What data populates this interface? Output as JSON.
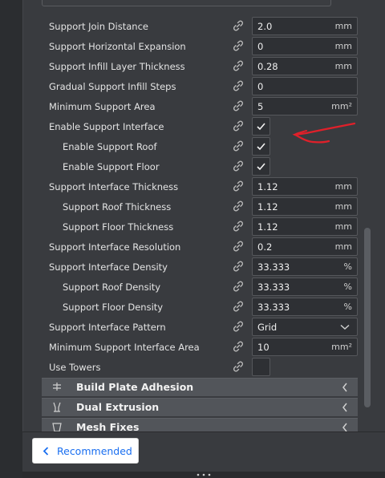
{
  "settings": [
    {
      "label": "Support Join Distance",
      "value": "2.0",
      "unit": "mm",
      "control": "field",
      "indent": 0
    },
    {
      "label": "Support Horizontal Expansion",
      "value": "0",
      "unit": "mm",
      "control": "field",
      "indent": 0
    },
    {
      "label": "Support Infill Layer Thickness",
      "value": "0.28",
      "unit": "mm",
      "control": "field",
      "indent": 0
    },
    {
      "label": "Gradual Support Infill Steps",
      "value": "0",
      "unit": "",
      "control": "field",
      "indent": 0
    },
    {
      "label": "Minimum Support Area",
      "value": "5",
      "unit": "mm²",
      "control": "field",
      "indent": 0
    },
    {
      "label": "Enable Support Interface",
      "checked": true,
      "control": "checkbox",
      "indent": 0
    },
    {
      "label": "Enable Support Roof",
      "checked": true,
      "control": "checkbox",
      "indent": 1
    },
    {
      "label": "Enable Support Floor",
      "checked": true,
      "control": "checkbox",
      "indent": 1
    },
    {
      "label": "Support Interface Thickness",
      "value": "1.12",
      "unit": "mm",
      "control": "field",
      "indent": 0
    },
    {
      "label": "Support Roof Thickness",
      "value": "1.12",
      "unit": "mm",
      "control": "field",
      "indent": 1
    },
    {
      "label": "Support Floor Thickness",
      "value": "1.12",
      "unit": "mm",
      "control": "field",
      "indent": 1
    },
    {
      "label": "Support Interface Resolution",
      "value": "0.2",
      "unit": "mm",
      "control": "field",
      "indent": 0
    },
    {
      "label": "Support Interface Density",
      "value": "33.333",
      "unit": "%",
      "control": "field",
      "indent": 0
    },
    {
      "label": "Support Roof Density",
      "value": "33.333",
      "unit": "%",
      "control": "field",
      "indent": 1
    },
    {
      "label": "Support Floor Density",
      "value": "33.333",
      "unit": "%",
      "control": "field",
      "indent": 1
    },
    {
      "label": "Support Interface Pattern",
      "value": "Grid",
      "control": "select",
      "indent": 0
    },
    {
      "label": "Minimum Support Interface Area",
      "value": "10",
      "unit": "mm²",
      "control": "field",
      "indent": 0
    },
    {
      "label": "Use Towers",
      "checked": false,
      "control": "checkbox",
      "indent": 0
    }
  ],
  "categories": [
    {
      "label": "Build Plate Adhesion",
      "icon": "build-plate-adhesion-icon"
    },
    {
      "label": "Dual Extrusion",
      "icon": "dual-extrusion-icon"
    },
    {
      "label": "Mesh Fixes",
      "icon": "mesh-fixes-icon"
    }
  ],
  "footer": {
    "recommended_label": "Recommended"
  },
  "colors": {
    "panel": "#393b3f",
    "field": "#2e3034",
    "category": "#52555a",
    "accent": "#196ef0",
    "annotation": "#e0202a"
  }
}
